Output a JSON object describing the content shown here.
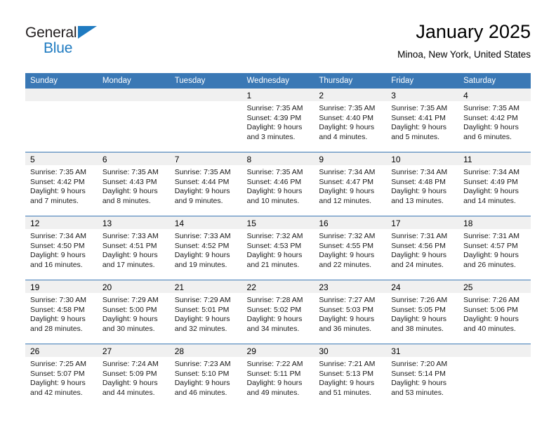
{
  "brand": {
    "name_part1": "General",
    "name_part2": "Blue"
  },
  "header": {
    "title": "January 2025",
    "subtitle": "Minoa, New York, United States"
  },
  "colors": {
    "header_blue": "#3a78b5",
    "logo_blue": "#1f7bc1",
    "daynum_band": "#f0f0f0"
  },
  "weekdays": [
    "Sunday",
    "Monday",
    "Tuesday",
    "Wednesday",
    "Thursday",
    "Friday",
    "Saturday"
  ],
  "weeks": [
    [
      {
        "day": "",
        "lines": []
      },
      {
        "day": "",
        "lines": []
      },
      {
        "day": "",
        "lines": []
      },
      {
        "day": "1",
        "lines": [
          "Sunrise: 7:35 AM",
          "Sunset: 4:39 PM",
          "Daylight: 9 hours",
          "and 3 minutes."
        ]
      },
      {
        "day": "2",
        "lines": [
          "Sunrise: 7:35 AM",
          "Sunset: 4:40 PM",
          "Daylight: 9 hours",
          "and 4 minutes."
        ]
      },
      {
        "day": "3",
        "lines": [
          "Sunrise: 7:35 AM",
          "Sunset: 4:41 PM",
          "Daylight: 9 hours",
          "and 5 minutes."
        ]
      },
      {
        "day": "4",
        "lines": [
          "Sunrise: 7:35 AM",
          "Sunset: 4:42 PM",
          "Daylight: 9 hours",
          "and 6 minutes."
        ]
      }
    ],
    [
      {
        "day": "5",
        "lines": [
          "Sunrise: 7:35 AM",
          "Sunset: 4:42 PM",
          "Daylight: 9 hours",
          "and 7 minutes."
        ]
      },
      {
        "day": "6",
        "lines": [
          "Sunrise: 7:35 AM",
          "Sunset: 4:43 PM",
          "Daylight: 9 hours",
          "and 8 minutes."
        ]
      },
      {
        "day": "7",
        "lines": [
          "Sunrise: 7:35 AM",
          "Sunset: 4:44 PM",
          "Daylight: 9 hours",
          "and 9 minutes."
        ]
      },
      {
        "day": "8",
        "lines": [
          "Sunrise: 7:35 AM",
          "Sunset: 4:46 PM",
          "Daylight: 9 hours",
          "and 10 minutes."
        ]
      },
      {
        "day": "9",
        "lines": [
          "Sunrise: 7:34 AM",
          "Sunset: 4:47 PM",
          "Daylight: 9 hours",
          "and 12 minutes."
        ]
      },
      {
        "day": "10",
        "lines": [
          "Sunrise: 7:34 AM",
          "Sunset: 4:48 PM",
          "Daylight: 9 hours",
          "and 13 minutes."
        ]
      },
      {
        "day": "11",
        "lines": [
          "Sunrise: 7:34 AM",
          "Sunset: 4:49 PM",
          "Daylight: 9 hours",
          "and 14 minutes."
        ]
      }
    ],
    [
      {
        "day": "12",
        "lines": [
          "Sunrise: 7:34 AM",
          "Sunset: 4:50 PM",
          "Daylight: 9 hours",
          "and 16 minutes."
        ]
      },
      {
        "day": "13",
        "lines": [
          "Sunrise: 7:33 AM",
          "Sunset: 4:51 PM",
          "Daylight: 9 hours",
          "and 17 minutes."
        ]
      },
      {
        "day": "14",
        "lines": [
          "Sunrise: 7:33 AM",
          "Sunset: 4:52 PM",
          "Daylight: 9 hours",
          "and 19 minutes."
        ]
      },
      {
        "day": "15",
        "lines": [
          "Sunrise: 7:32 AM",
          "Sunset: 4:53 PM",
          "Daylight: 9 hours",
          "and 21 minutes."
        ]
      },
      {
        "day": "16",
        "lines": [
          "Sunrise: 7:32 AM",
          "Sunset: 4:55 PM",
          "Daylight: 9 hours",
          "and 22 minutes."
        ]
      },
      {
        "day": "17",
        "lines": [
          "Sunrise: 7:31 AM",
          "Sunset: 4:56 PM",
          "Daylight: 9 hours",
          "and 24 minutes."
        ]
      },
      {
        "day": "18",
        "lines": [
          "Sunrise: 7:31 AM",
          "Sunset: 4:57 PM",
          "Daylight: 9 hours",
          "and 26 minutes."
        ]
      }
    ],
    [
      {
        "day": "19",
        "lines": [
          "Sunrise: 7:30 AM",
          "Sunset: 4:58 PM",
          "Daylight: 9 hours",
          "and 28 minutes."
        ]
      },
      {
        "day": "20",
        "lines": [
          "Sunrise: 7:29 AM",
          "Sunset: 5:00 PM",
          "Daylight: 9 hours",
          "and 30 minutes."
        ]
      },
      {
        "day": "21",
        "lines": [
          "Sunrise: 7:29 AM",
          "Sunset: 5:01 PM",
          "Daylight: 9 hours",
          "and 32 minutes."
        ]
      },
      {
        "day": "22",
        "lines": [
          "Sunrise: 7:28 AM",
          "Sunset: 5:02 PM",
          "Daylight: 9 hours",
          "and 34 minutes."
        ]
      },
      {
        "day": "23",
        "lines": [
          "Sunrise: 7:27 AM",
          "Sunset: 5:03 PM",
          "Daylight: 9 hours",
          "and 36 minutes."
        ]
      },
      {
        "day": "24",
        "lines": [
          "Sunrise: 7:26 AM",
          "Sunset: 5:05 PM",
          "Daylight: 9 hours",
          "and 38 minutes."
        ]
      },
      {
        "day": "25",
        "lines": [
          "Sunrise: 7:26 AM",
          "Sunset: 5:06 PM",
          "Daylight: 9 hours",
          "and 40 minutes."
        ]
      }
    ],
    [
      {
        "day": "26",
        "lines": [
          "Sunrise: 7:25 AM",
          "Sunset: 5:07 PM",
          "Daylight: 9 hours",
          "and 42 minutes."
        ]
      },
      {
        "day": "27",
        "lines": [
          "Sunrise: 7:24 AM",
          "Sunset: 5:09 PM",
          "Daylight: 9 hours",
          "and 44 minutes."
        ]
      },
      {
        "day": "28",
        "lines": [
          "Sunrise: 7:23 AM",
          "Sunset: 5:10 PM",
          "Daylight: 9 hours",
          "and 46 minutes."
        ]
      },
      {
        "day": "29",
        "lines": [
          "Sunrise: 7:22 AM",
          "Sunset: 5:11 PM",
          "Daylight: 9 hours",
          "and 49 minutes."
        ]
      },
      {
        "day": "30",
        "lines": [
          "Sunrise: 7:21 AM",
          "Sunset: 5:13 PM",
          "Daylight: 9 hours",
          "and 51 minutes."
        ]
      },
      {
        "day": "31",
        "lines": [
          "Sunrise: 7:20 AM",
          "Sunset: 5:14 PM",
          "Daylight: 9 hours",
          "and 53 minutes."
        ]
      },
      {
        "day": "",
        "lines": []
      }
    ]
  ]
}
